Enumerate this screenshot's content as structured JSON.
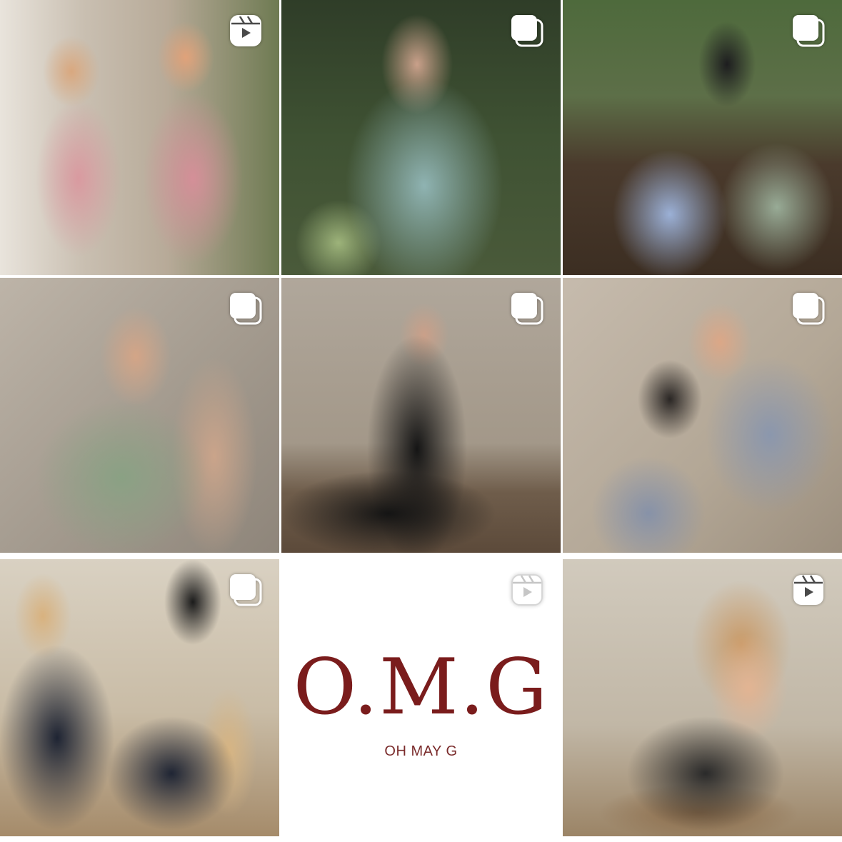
{
  "grid": {
    "posts": [
      {
        "type": "reel",
        "badge_icon": "reels-icon",
        "colors": [
          "#d99aa0",
          "#c9bfb1"
        ]
      },
      {
        "type": "carousel",
        "badge_icon": "carousel-icon",
        "colors": [
          "#8fb3b2",
          "#3f5233"
        ]
      },
      {
        "type": "carousel",
        "badge_icon": "carousel-icon",
        "colors": [
          "#9bb0d6",
          "#98ab96"
        ]
      },
      {
        "type": "carousel",
        "badge_icon": "carousel-icon",
        "colors": [
          "#8aa184",
          "#a39a8e"
        ]
      },
      {
        "type": "carousel",
        "badge_icon": "carousel-icon",
        "colors": [
          "#151515",
          "#a39889"
        ]
      },
      {
        "type": "carousel",
        "badge_icon": "carousel-icon",
        "colors": [
          "#8b97ad",
          "#b3a796"
        ]
      },
      {
        "type": "carousel",
        "badge_icon": "carousel-icon",
        "colors": [
          "#1e2433",
          "#d9d1c2"
        ]
      },
      {
        "type": "reel",
        "badge_icon": "reels-icon",
        "colors": [
          "#ffffff",
          "#7a1c1c"
        ]
      },
      {
        "type": "reel",
        "badge_icon": "reels-icon",
        "colors": [
          "#2a2a2a",
          "#c1b7a6"
        ]
      }
    ]
  },
  "logo_post": {
    "title": "O.M.G",
    "subtitle": "OH MAY G",
    "title_color": "#7a1c1c",
    "subtitle_color": "#7a2b2b"
  }
}
